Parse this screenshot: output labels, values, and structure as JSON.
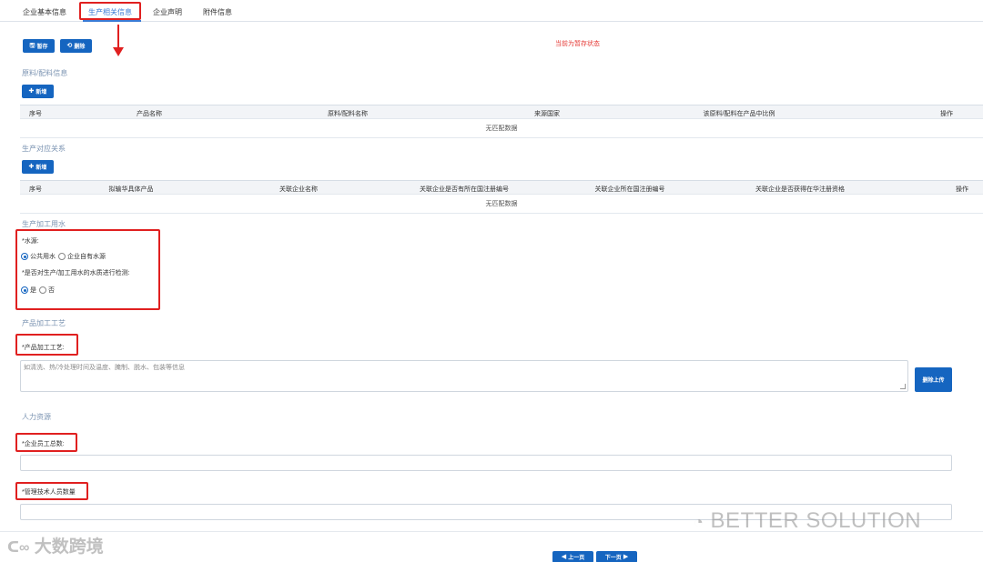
{
  "tabs": [
    {
      "label": "企业基本信息"
    },
    {
      "label": "生产相关信息"
    },
    {
      "label": "企业声明"
    },
    {
      "label": "附件信息"
    }
  ],
  "toolbar": {
    "save_label": "暂存",
    "delete_label": "删除",
    "save_icon": "save-icon",
    "delete_icon": "refresh-icon"
  },
  "status_text": "当前为暂存状态",
  "materials": {
    "title": "原料/配料信息",
    "add_label": "新增",
    "columns": [
      "序号",
      "产品名称",
      "原料/配料名称",
      "来源国家",
      "该原料/配料在产品中比例",
      "操作"
    ],
    "empty_text": "无匹配数据"
  },
  "relations": {
    "title": "生产对应关系",
    "add_label": "新增",
    "columns": [
      "序号",
      "拟输华具体产品",
      "关联企业名称",
      "关联企业是否有所在国注册编号",
      "关联企业所在国注册编号",
      "关联企业是否获得在华注册资格",
      "操作"
    ],
    "empty_text": "无匹配数据"
  },
  "water": {
    "title": "生产加工用水",
    "source_label": "*水源:",
    "source_options": [
      {
        "label": "公共用水",
        "checked": true
      },
      {
        "label": "企业自有水源",
        "checked": false
      }
    ],
    "test_label": "*是否对生产/加工用水的水质进行检测:",
    "test_options": [
      {
        "label": "是",
        "checked": true
      },
      {
        "label": "否",
        "checked": false
      }
    ]
  },
  "process": {
    "title": "产品加工工艺",
    "field_label": "*产品加工工艺:",
    "placeholder": "如清洗、热/冷处理时间及温度、腌制、脱水、包装等信息",
    "upload_label": "删除上传"
  },
  "hr": {
    "title": "人力资源",
    "employees_label": "*企业员工总数:",
    "tech_label": "*管理技术人员数量"
  },
  "pagination": {
    "prev_label": "上一页",
    "next_label": "下一页"
  },
  "watermarks": {
    "left": "大数跨境",
    "right": "BETTER SOLUTION"
  },
  "colors": {
    "accent": "#1565c0",
    "tab_active": "#3a7bd5",
    "annotation_red": "#e02020",
    "status_red": "#e53935",
    "section_title": "#7d95b3"
  }
}
